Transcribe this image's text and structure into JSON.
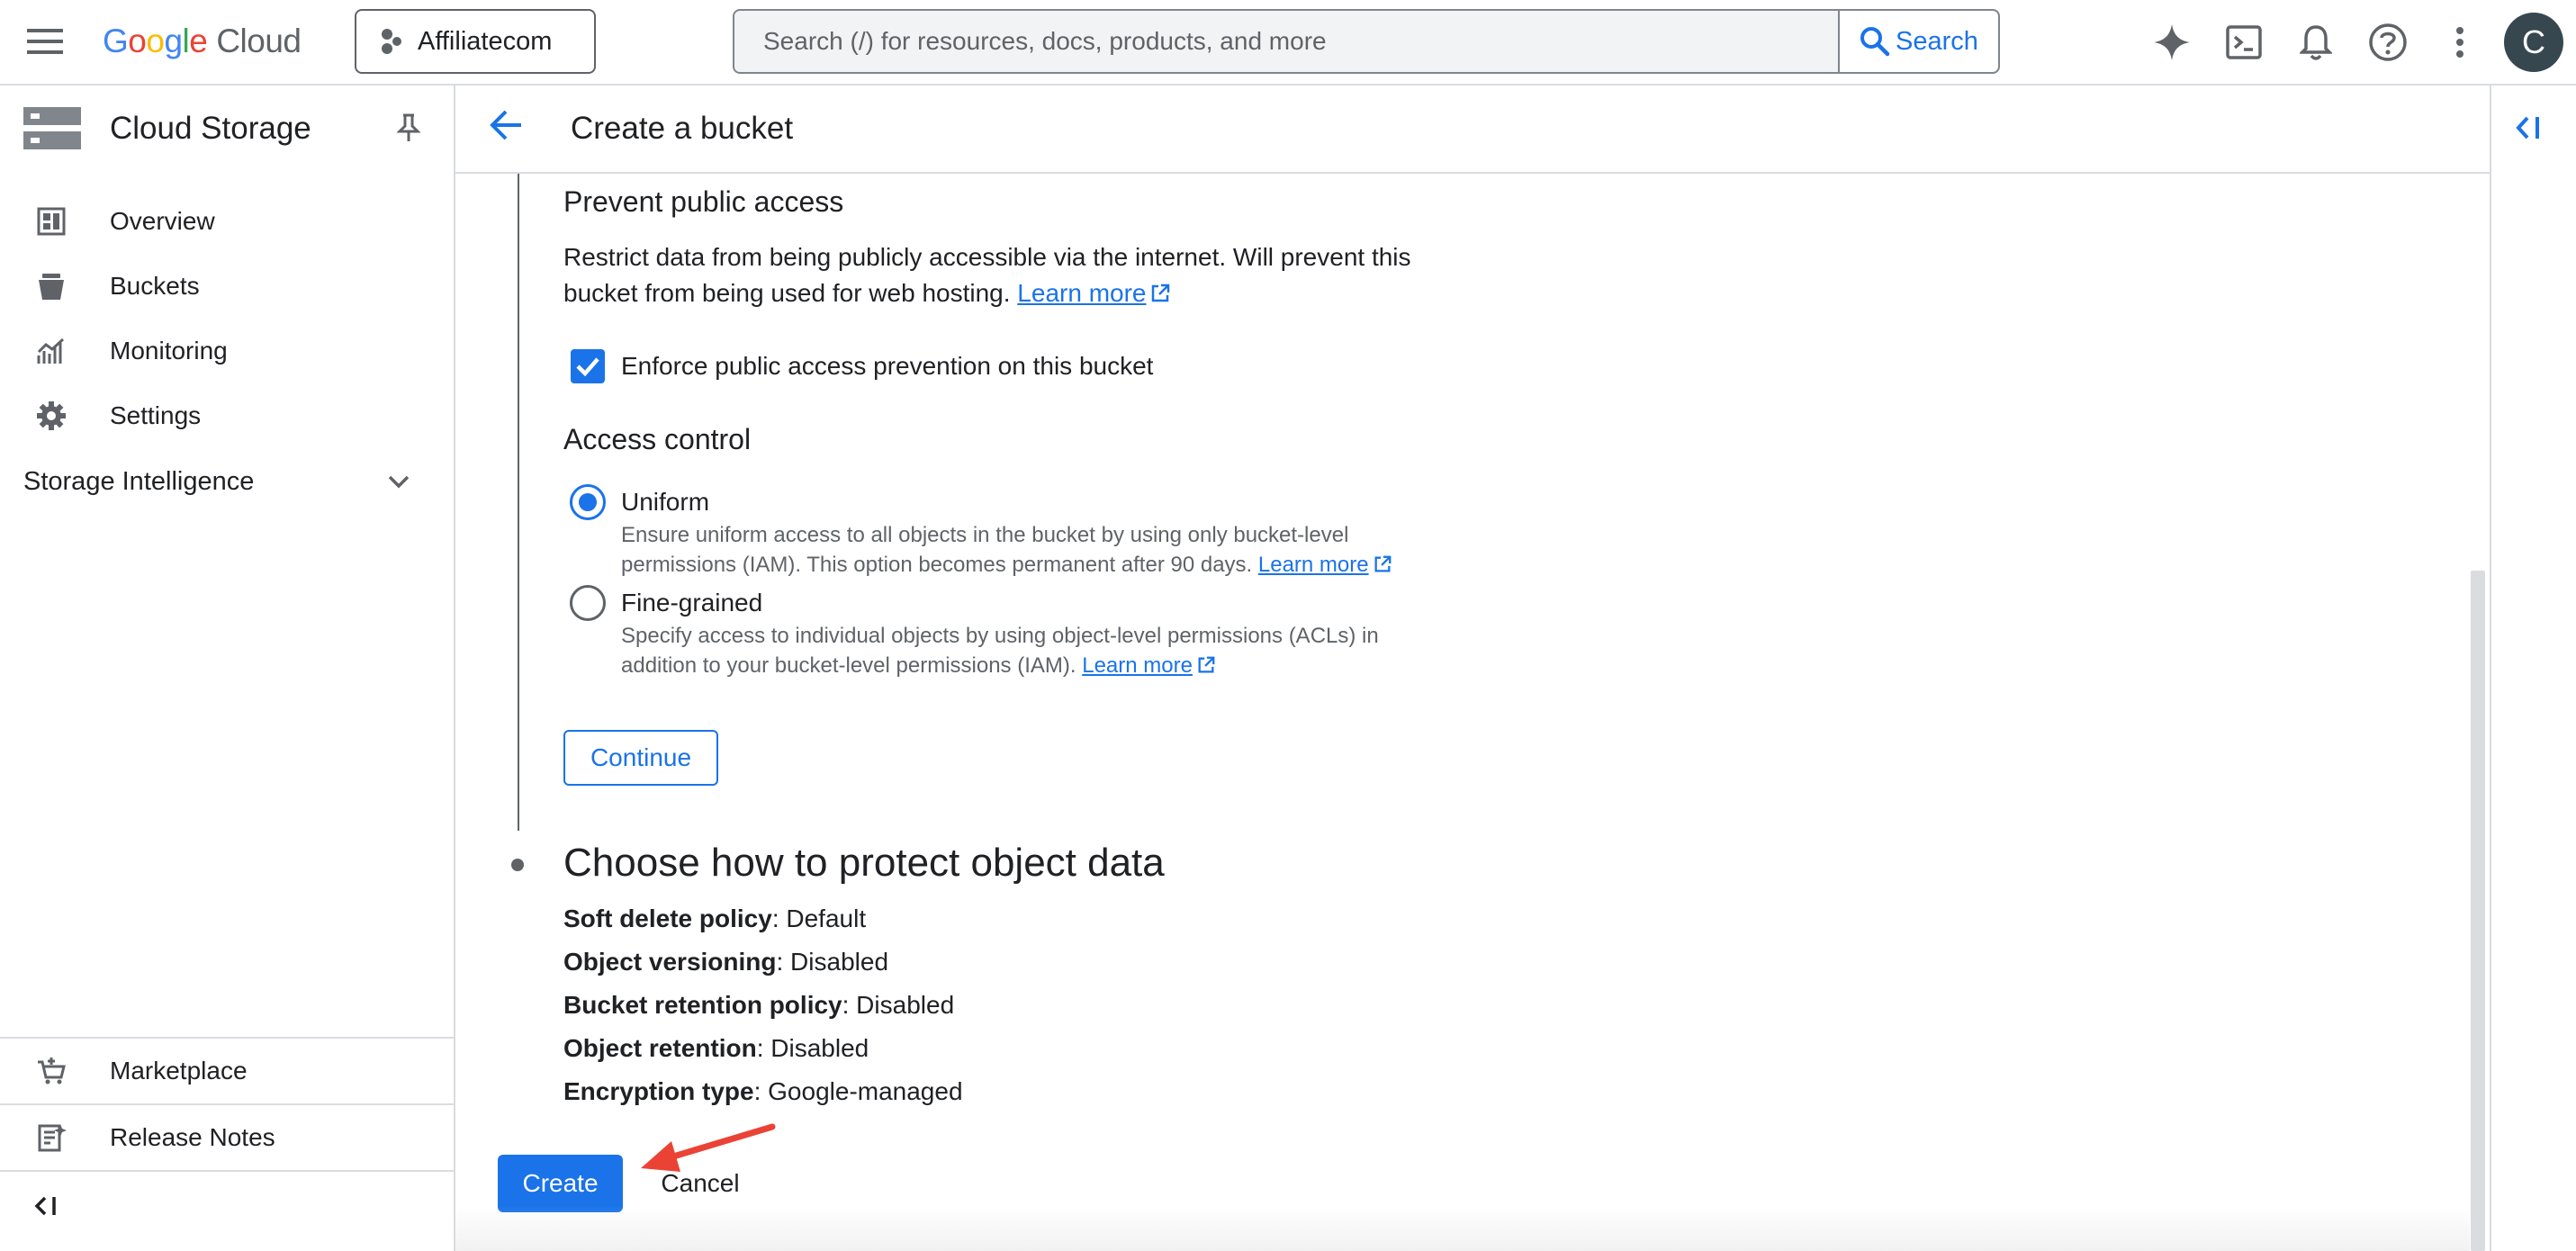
{
  "topbar": {
    "logo_letters": [
      "G",
      "o",
      "o",
      "g",
      "l",
      "e"
    ],
    "logo_suffix": "Cloud",
    "project_name": "Affiliatecom",
    "search_placeholder": "Search (/) for resources, docs, products, and more",
    "search_button": "Search",
    "avatar_initial": "C",
    "icons": [
      "menu-icon",
      "gemini-sparkle-icon",
      "cloud-shell-icon",
      "notifications-bell-icon",
      "help-icon",
      "more-vert-icon"
    ]
  },
  "sidebar": {
    "product_title": "Cloud Storage",
    "items": [
      {
        "label": "Overview",
        "icon": "dashboard-icon"
      },
      {
        "label": "Buckets",
        "icon": "bucket-icon"
      },
      {
        "label": "Monitoring",
        "icon": "monitoring-icon"
      },
      {
        "label": "Settings",
        "icon": "gear-icon"
      }
    ],
    "section": "Storage Intelligence",
    "bottom_items": [
      {
        "label": "Marketplace",
        "icon": "marketplace-cart-icon"
      },
      {
        "label": "Release Notes",
        "icon": "release-notes-icon"
      }
    ]
  },
  "main": {
    "title": "Create a bucket",
    "prevent_public": {
      "heading": "Prevent public access",
      "description": "Restrict data from being publicly accessible via the internet. Will prevent this bucket from being used for web hosting.",
      "learn_more": "Learn more",
      "checkbox_label": "Enforce public access prevention on this bucket",
      "checkbox_checked": true
    },
    "access_control": {
      "heading": "Access control",
      "selected": "Uniform",
      "options": [
        {
          "label": "Uniform",
          "description": "Ensure uniform access to all objects in the bucket by using only bucket-level permissions (IAM). This option becomes permanent after 90 days.",
          "learn_more": "Learn more"
        },
        {
          "label": "Fine-grained",
          "description": "Specify access to individual objects by using object-level permissions (ACLs) in addition to your bucket-level permissions (IAM).",
          "learn_more": "Learn more"
        }
      ]
    },
    "continue_button": "Continue",
    "protect": {
      "heading": "Choose how to protect object data",
      "rows": [
        {
          "key": "Soft delete policy",
          "value": ": Default"
        },
        {
          "key": "Object versioning",
          "value": ": Disabled"
        },
        {
          "key": "Bucket retention policy",
          "value": ": Disabled"
        },
        {
          "key": "Object retention",
          "value": ": Disabled"
        },
        {
          "key": "Encryption type",
          "value": ": Google-managed"
        }
      ]
    },
    "create_button": "Create",
    "cancel_button": "Cancel"
  },
  "colors": {
    "accent": "#1a73e8",
    "annotation_arrow": "#ea4335",
    "text": "#202124",
    "muted": "#5f6368",
    "divider": "#dadce0"
  }
}
